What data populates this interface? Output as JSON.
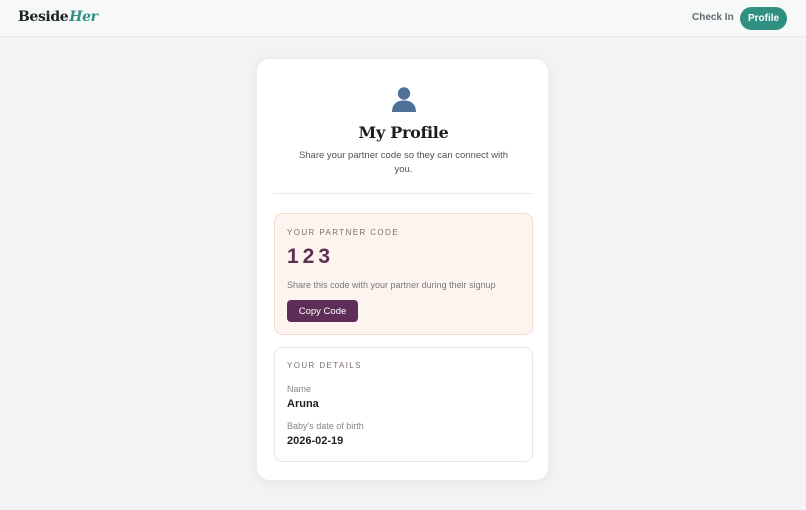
{
  "nav": {
    "brand_main": "Beside",
    "brand_accent": "Her",
    "checkin_label": "Check In",
    "profile_label": "Profile"
  },
  "profile": {
    "avatar_icon": "user-silhouette-icon",
    "title": "My Profile",
    "subtitle": "Share your partner code so they can connect with you."
  },
  "partner_code": {
    "section_label": "YOUR PARTNER CODE",
    "code": "123",
    "hint": "Share this code with your partner during their signup",
    "copy_label": "Copy Code"
  },
  "details": {
    "section_label": "YOUR DETAILS",
    "name_label": "Name",
    "name_value": "Aruna",
    "dob_label": "Baby's date of birth",
    "dob_value": "2026-02-19"
  },
  "colors": {
    "accent": "#2f8f80",
    "code_text": "#5c2f55",
    "copy_button": "#5f2e58",
    "code_box_bg": "#fdf3ef"
  }
}
